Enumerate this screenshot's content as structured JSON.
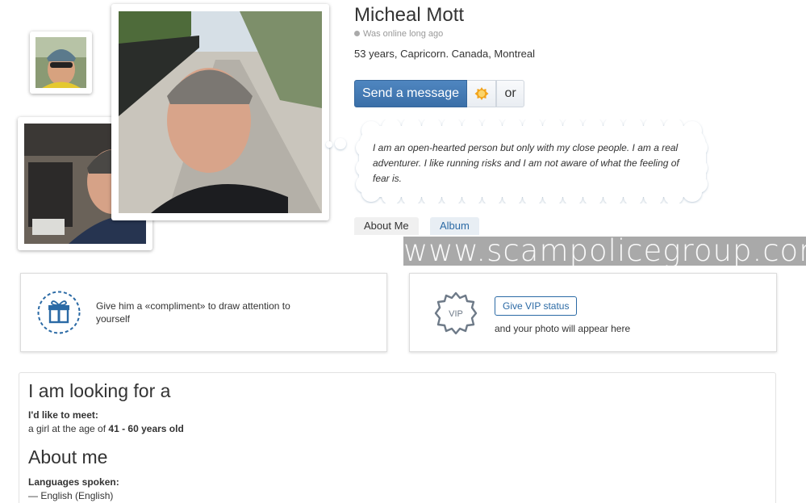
{
  "profile": {
    "name": "Micheal Mott",
    "status": "Was online long ago",
    "details": "53 years, Capricorn. Canada, Montreal",
    "quote": "I am an open-hearted person but only with my close people. I am a real adventurer. I like running risks and I am not aware of what the feeling of fear is."
  },
  "actions": {
    "send_message": "Send a message",
    "vip_icon": "vip-badge-icon",
    "or": "or"
  },
  "tabs": [
    {
      "label": "About Me"
    },
    {
      "label": "Album"
    }
  ],
  "watermark": "www.scampolicegroup.com",
  "compliment_card": {
    "icon": "gift-icon",
    "text": "Give him a «compliment» to draw attention to yourself"
  },
  "vip_card": {
    "icon": "vip-badge-icon",
    "badge_text": "VIP",
    "button": "Give VIP status",
    "note": "and your photo will appear here"
  },
  "looking_for": {
    "title": "I am looking for a",
    "label": "I'd like to meet:",
    "value_prefix": "a girl at the age of ",
    "value_range": "41 - 60 years old"
  },
  "about": {
    "title": "About me",
    "label": "Languages spoken:",
    "value": "— English (English)"
  },
  "colors": {
    "accent": "#3a6fa8",
    "link": "#2b6aa5",
    "watermark_bg": "#a9a9a9"
  }
}
